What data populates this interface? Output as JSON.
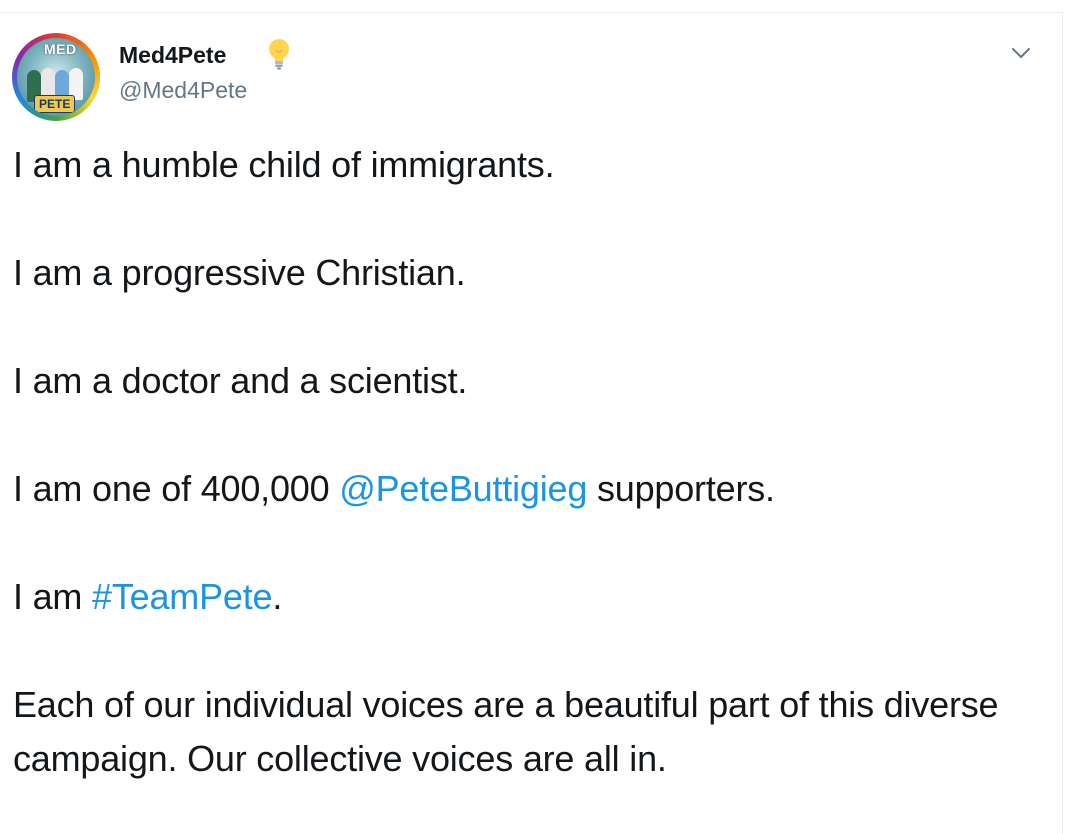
{
  "colors": {
    "text": "#14171a",
    "secondary_text": "#657786",
    "link": "#1b95e0",
    "border": "#e6ecf0"
  },
  "tweet": {
    "author": {
      "display_name": "Med4Pete",
      "handle": "@Med4Pete",
      "avatar_top_text": "MED",
      "avatar_bottom_text": "PETE",
      "badge_icon": "light-bulb-icon"
    },
    "menu_icon": "chevron-down-icon",
    "lines": {
      "line1": "I am a humble child of immigrants.",
      "line2": "I am a progressive Christian.",
      "line3": "I am a doctor and a scientist.",
      "line4_pre": "I am one of 400,000 ",
      "line4_mention": "@PeteButtigieg",
      "line4_post": " supporters.",
      "line5_pre": "I am ",
      "line5_hashtag": "#TeamPete",
      "line5_post": ".",
      "line6": "Each of our individual voices are a beautiful part of this diverse campaign. Our collective voices are all in."
    }
  }
}
